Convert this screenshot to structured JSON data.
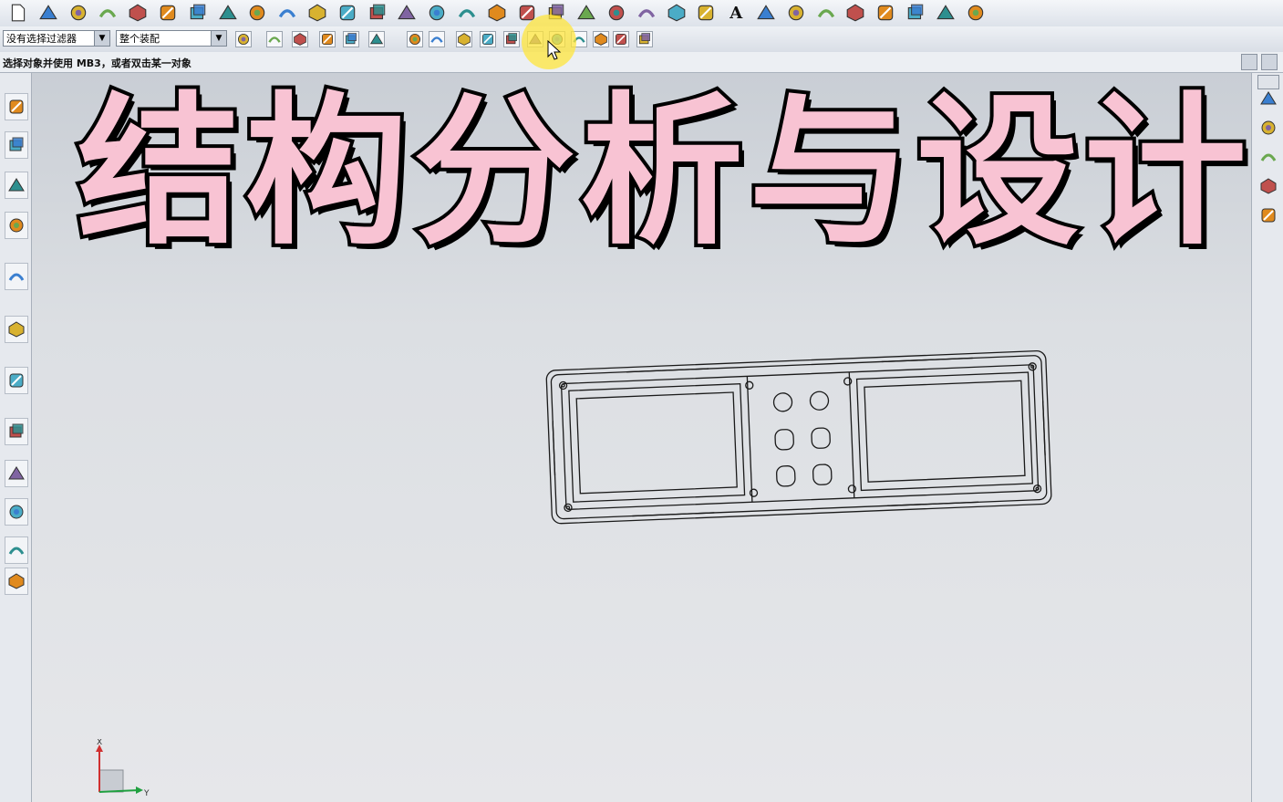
{
  "toolbar_row2": {
    "filter_select": "没有选择过滤器",
    "scope_select": "整个装配"
  },
  "status_bar": {
    "prompt": "选择对象并使用 MB3，或者双击某一对象"
  },
  "overlay": {
    "title": "结构分析与设计"
  },
  "triad": {
    "x_label": "X",
    "y_label": "Y"
  },
  "icons": {
    "row1": [
      "new-file-icon",
      "block-icon",
      "sweep-icon",
      "cylinder-icon",
      "edit-icon",
      "extrude-icon",
      "pad-icon",
      "pattern-icon",
      "unite-icon",
      "box-icon",
      "revolve-icon",
      "chamfer-icon",
      "shell-icon",
      "blend-icon",
      "trim-icon",
      "wave-icon",
      "cube-icon",
      "rounded-icon",
      "curve-icon",
      "datum-plane-icon",
      "solid-icon",
      "wireframe-icon",
      "line-icon",
      "arc-icon",
      "text-icon",
      "spline-icon",
      "helix-icon",
      "offset-icon",
      "bridge-icon",
      "project-icon",
      "intersect-icon",
      "point-icon",
      "gear-icon"
    ],
    "row2": [
      "filter-icon",
      "snap-icon",
      "select-icon",
      "box-select-icon",
      "view-icon",
      "shaded-icon",
      "snap-point-icon",
      "snap-end-icon",
      "snap-mid-icon",
      "snap-control-icon",
      "snap-intersect-icon",
      "snap-center-icon",
      "snap-quadrant-icon",
      "snap-point-on-icon",
      "snap-existing-icon",
      "snap-bounded-icon",
      "layer-icon"
    ],
    "left_bar": [
      "assembly-navigator-icon",
      "constraint-icon",
      "part-navigator-icon",
      "reuse-library-icon",
      "info-icon",
      "web-browser-icon",
      "history-icon",
      "system-materials-icon",
      "process-studio-icon",
      "manufacturing-wizard-icon",
      "roles-icon",
      "system-scenes-icon"
    ],
    "right_bar": [
      "render-icon",
      "face-icon",
      "layout-icon",
      "color-icon",
      "pipe-icon"
    ]
  },
  "colors": {
    "title_fill": "#f8c3d3",
    "title_outline": "#000000",
    "cursor_highlight": "#ffe63c"
  }
}
